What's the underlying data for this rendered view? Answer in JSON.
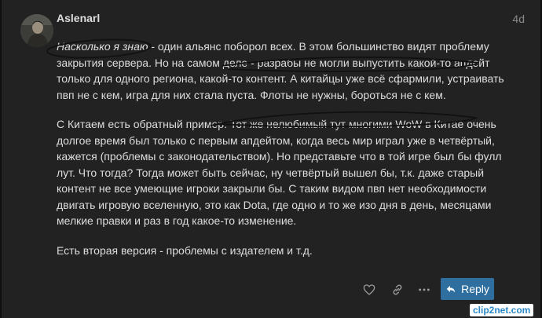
{
  "post": {
    "username": "Aslenarl",
    "date": "4d",
    "paragraphs": [
      {
        "italic": "Насколько я знаю",
        "text": " - один альянс поборол всех. В этом большинство видят проблему закрытия сервера. Но на самом деле - разрабы не могли выпустить какой-то апдейт только для одного региона, какой-то контент. А китайцы уже всё сфармили, устраивать пвп не с кем, игра для них стала пуста. Флоты не нужны, бороться не с кем."
      },
      {
        "italic": "",
        "text": "С Китаем есть обратный пример. Тот же нелюбимый тут многими WoW в Китае очень долгое время был только с первым апдейтом, когда весь мир играл уже в четвёртый, кажется (проблемы с законодательством). Но представьте что в той игре был бы фулл лут. Что тогда? Тогда может быть сейчас, ну четвёртый вышел бы, т.к. даже старый контент не все умеющие игроки закрыли бы. С таким видом пвп нет необходимости двигать игровую вселенную, это как Dota, где одно и то же изо дня в день, месяцами мелкие правки и раз в год какое-то изменение."
      },
      {
        "italic": "",
        "text": "Есть вторая версия - проблемы с издателем и т.д."
      }
    ]
  },
  "actions": {
    "like_icon": "heart-icon",
    "link_icon": "link-icon",
    "more_icon": "ellipsis-icon",
    "reply_icon": "reply-arrow-icon",
    "reply_label": "Reply"
  },
  "watermark": "clip2net.com",
  "colors": {
    "background": "#222222",
    "text": "#dddddd",
    "muted": "#8a8a8a",
    "reply_button": "#2f6f9f"
  }
}
